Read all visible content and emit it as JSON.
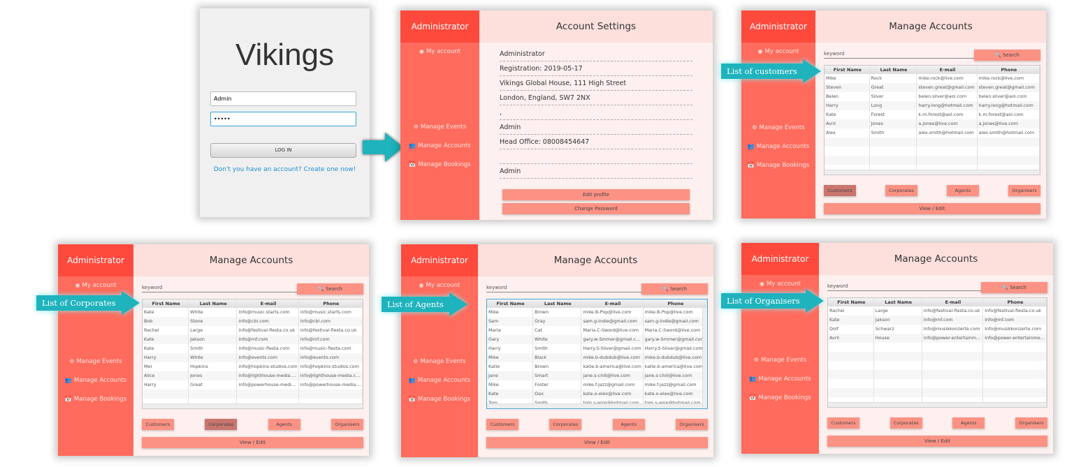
{
  "login": {
    "app_name": "Vikings",
    "username_value": "Admin",
    "password_value": "•••••",
    "login_button": "LOG IN",
    "signup_link": "Don't you have an account? Create one now!"
  },
  "sidebar": {
    "role": "Administrator",
    "my_account": "My account",
    "manage_events": "Manage Events",
    "manage_accounts": "Manage Accounts",
    "manage_bookings": "Manage Bookings"
  },
  "account_settings": {
    "title": "Account Settings",
    "lines": [
      "Administrator",
      "Registration:  2019-05-17",
      "Vikings Global House, 111 High Street",
      "London, England, SW7 2NX",
      ",",
      "Admin",
      "Head Office: 08008454647",
      "",
      "Admin"
    ],
    "edit_profile": "Edit profile",
    "change_password": "Change Password"
  },
  "manage": {
    "title": "Manage Accounts",
    "keyword_placeholder": "keyword",
    "search": "Search",
    "columns": [
      "First Name",
      "Last Name",
      "E-mail",
      "Phone"
    ],
    "buttons": [
      "Customers",
      "Corporates",
      "Agents",
      "Organisers"
    ],
    "view_edit": "View / Edit"
  },
  "panels": [
    {
      "callout": "List of customers",
      "selected": "Customers",
      "rows": [
        [
          "Mike",
          "Rock",
          "mike.rock@live.com",
          "mike.rock@live.com"
        ],
        [
          "Steven",
          "Great",
          "steven.great@gmail.com",
          "steven.great@gmail.com"
        ],
        [
          "Belen",
          "Silver",
          "belen.silver@aol.com",
          "belen.silver@aol.com"
        ],
        [
          "Harry",
          "Long",
          "harry.long@hotmail.com",
          "harry.long@hotmail.com"
        ],
        [
          "Kate",
          "Forest",
          "k.m.forest@aol.com",
          "k.m.forest@aol.com"
        ],
        [
          "Avril",
          "Jones",
          "a.jones@live.com",
          "a.jones@live.com"
        ],
        [
          "Alex",
          "Smith",
          "alex.smith@hotmail.com",
          "alex.smith@hotmail.com"
        ]
      ]
    },
    {
      "callout": "List of Corporates",
      "selected": "Corporates",
      "rows": [
        [
          "Kate",
          "White",
          "info@music.starts.com",
          "info@music.starts.com"
        ],
        [
          "Bob",
          "Stone",
          "info@cbl.com",
          "info@cbl.com"
        ],
        [
          "Rachel",
          "Large",
          "info@festival-fiesta.co.uk",
          "info@festival-fiesta.co.uk"
        ],
        [
          "Kate",
          "Jakson",
          "info@mf.com",
          "info@mf.com"
        ],
        [
          "Kate",
          "Smith",
          "info@music-fiesta.com",
          "info@music-fiesta.com"
        ],
        [
          "Harry",
          "White",
          "info@events.com",
          "info@events.com"
        ],
        [
          "Mel",
          "Hopkins",
          "info@hopkins-studios.com",
          "info@hopkins-studios.com"
        ],
        [
          "Alice",
          "Jones",
          "info@lighthouse-media.com",
          "info@lighthouse-media.com"
        ],
        [
          "Harry",
          "Great",
          "info@powerhouse-media.com",
          "info@powerhouse-media.com"
        ]
      ]
    },
    {
      "callout": "List of Agents",
      "selected": "",
      "rows": [
        [
          "Mike",
          "Brown",
          "mike.B-Pop@live.com",
          "mike.B-Pop@live.com"
        ],
        [
          "Sam",
          "Gray",
          "sam.g-indie@gmail.com",
          "sam.g-indie@gmail.com"
        ],
        [
          "Maria",
          "Cat",
          "Maria.C-Sword@live.com",
          "Maria.C-Sword@live.com"
        ],
        [
          "Gary",
          "White",
          "gary.w-Smmer@gmail.com",
          "gary.w-Smmer@gmail.com"
        ],
        [
          "Harry",
          "Smith",
          "Harry.S-Silver@gmail.com",
          "Harry.S-Silver@gmail.com"
        ],
        [
          "Mike",
          "Black",
          "mike.b-dubdub@live.com",
          "mike.b-dubdub@live.com"
        ],
        [
          "Katie",
          "Brown",
          "katie.b-america@live.com",
          "katie.b-america@live.com"
        ],
        [
          "Jane",
          "Smart",
          "jane.s-chill@live.com",
          "jane.s-chill@live.com"
        ],
        [
          "Mike",
          "Foster",
          "mike.f-jazz@gmail.com",
          "mike.f-jazz@gmail.com"
        ],
        [
          "Kate",
          "Oax",
          "kate.o-elex@live.com",
          "kate.o-elex@live.com"
        ],
        [
          "Tom",
          "Smith",
          "tom.s-wire@hotmail.com",
          "tom.s-wire@hotmail.com"
        ]
      ]
    },
    {
      "callout": "List of Organisers",
      "selected": "",
      "rows": [
        [
          "Rachel",
          "Large",
          "info@festival-fiesta.co.uk",
          "info@festival-fiesta.co.uk"
        ],
        [
          "Kate",
          "Jakson",
          "info@mf.com",
          "info@mf.com"
        ],
        [
          "Dolf",
          "Schwarz",
          "info@musikkonzerte.com",
          "info@musikkonzerte.com"
        ],
        [
          "Avril",
          "House",
          "info@power-entertainment.com",
          "info@power-entertainment.com"
        ]
      ]
    }
  ],
  "icons": {
    "my_account": "user-circle-icon",
    "events": "gears-icon",
    "accounts": "users-icon",
    "bookings": "calendar-check-icon",
    "search": "search-icon"
  },
  "colors": {
    "sidebar": "#ff6b5c",
    "sidebar_header": "#fe4a3d",
    "header": "#fde0dc",
    "button": "#fc9284",
    "button_selected": "#c9756e",
    "callout": "#1fb3bd"
  }
}
